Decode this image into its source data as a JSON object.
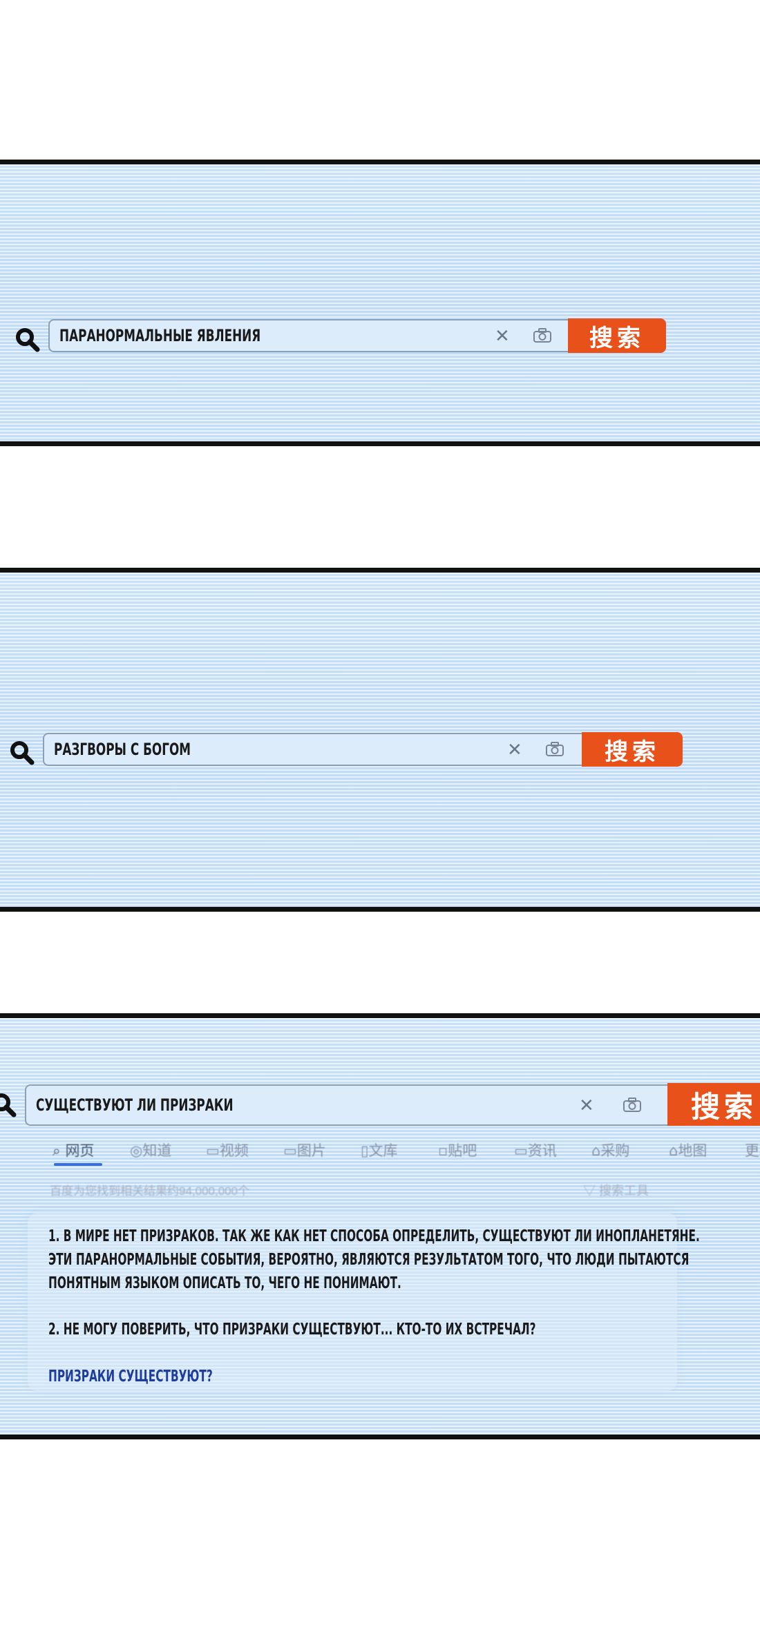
{
  "colors": {
    "search_button": "#e8511a",
    "panel_bg": "#cfe5fa",
    "link": "#1f3d9c",
    "tab_underline": "#3b6fd6"
  },
  "panel1": {
    "query": "ПАРАНОРМАЛЬНЫЕ ЯВЛЕНИЯ",
    "search_button_label": "搜索"
  },
  "panel2": {
    "query": "РАЗГВОРЫ С БОГОМ",
    "search_button_label": "搜索"
  },
  "panel3": {
    "query": "СУЩЕСТВУЮТ ЛИ ПРИЗРАКИ",
    "search_button_label": "搜索",
    "tabs": [
      {
        "label": "网页",
        "icon": "search-icon",
        "active": true
      },
      {
        "label": "知道",
        "icon": "question-icon",
        "active": false
      },
      {
        "label": "视频",
        "icon": "video-icon",
        "active": false
      },
      {
        "label": "图片",
        "icon": "image-icon",
        "active": false
      },
      {
        "label": "文库",
        "icon": "document-icon",
        "active": false
      },
      {
        "label": "贴吧",
        "icon": "forum-icon",
        "active": false
      },
      {
        "label": "资讯",
        "icon": "news-icon",
        "active": false
      },
      {
        "label": "采购",
        "icon": "shop-icon",
        "active": false
      },
      {
        "label": "地图",
        "icon": "map-icon",
        "active": false
      },
      {
        "label": "更",
        "icon": "",
        "active": false
      }
    ],
    "result_count": "百度为您找到相关结果约94,000,000个",
    "search_tools": "搜索工具",
    "result_lines": [
      "1. В МИРЕ НЕТ ПРИЗРАКОВ. ТАК ЖЕ КАК НЕТ СПОСОБА ОПРЕДЕЛИТЬ, СУЩЕСТВУЮТ ЛИ ИНОПЛАНЕТЯНЕ.",
      "ЭТИ ПАРАНОРМАЛЬНЫЕ СОБЫТИЯ, ВЕРОЯТНО, ЯВЛЯЮТСЯ РЕЗУЛЬТАТОМ ТОГО, ЧТО ЛЮДИ ПЫТАЮТСЯ",
      "ПОНЯТНЫМ ЯЗЫКОМ ОПИСАТЬ ТО, ЧЕГО НЕ ПОНИМАЮТ.",
      "2. НЕ МОГУ ПОВЕРИТЬ, ЧТО ПРИЗРАКИ СУЩЕСТВУЮТ... КТО-ТО ИХ ВСТРЕЧАЛ?"
    ],
    "link": "ПРИЗРАКИ СУЩЕСТВУЮТ?"
  }
}
